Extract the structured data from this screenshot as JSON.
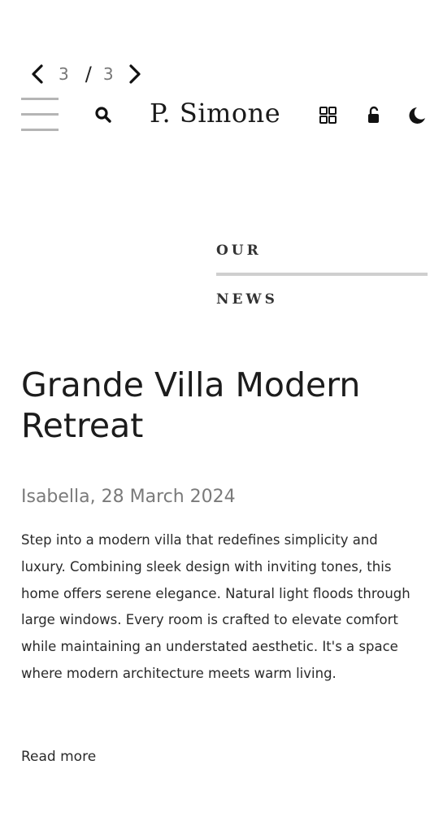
{
  "pager": {
    "current": "3",
    "separator": "/",
    "total": "3",
    "prev_icon": "chevron-left-icon",
    "next_icon": "chevron-right-icon"
  },
  "header": {
    "menu_icon": "hamburger-menu-icon",
    "search_icon": "search-icon",
    "logo": "P. Simone",
    "grid_icon": "grid-icon",
    "lock_icon": "lock-icon",
    "theme_icon": "moon-icon"
  },
  "section": {
    "line1": "OUR",
    "line2": "NEWS"
  },
  "article": {
    "title": "Grande Villa Modern Retreat",
    "byline": "Isabella, 28 March 2024",
    "excerpt": "Step into a modern villa that redefines simplicity and luxury. Combining sleek design with inviting tones, this home offers serene elegance. Natural light floods through large windows. Every room is crafted to elevate comfort while maintaining an understated aesthetic. It's a space where modern architecture meets warm living.",
    "read_more": "Read more"
  },
  "colors": {
    "text": "#222222",
    "muted": "#7a7a7a",
    "rule": "#cfcfcf",
    "hamburger": "#b5b5b5"
  }
}
